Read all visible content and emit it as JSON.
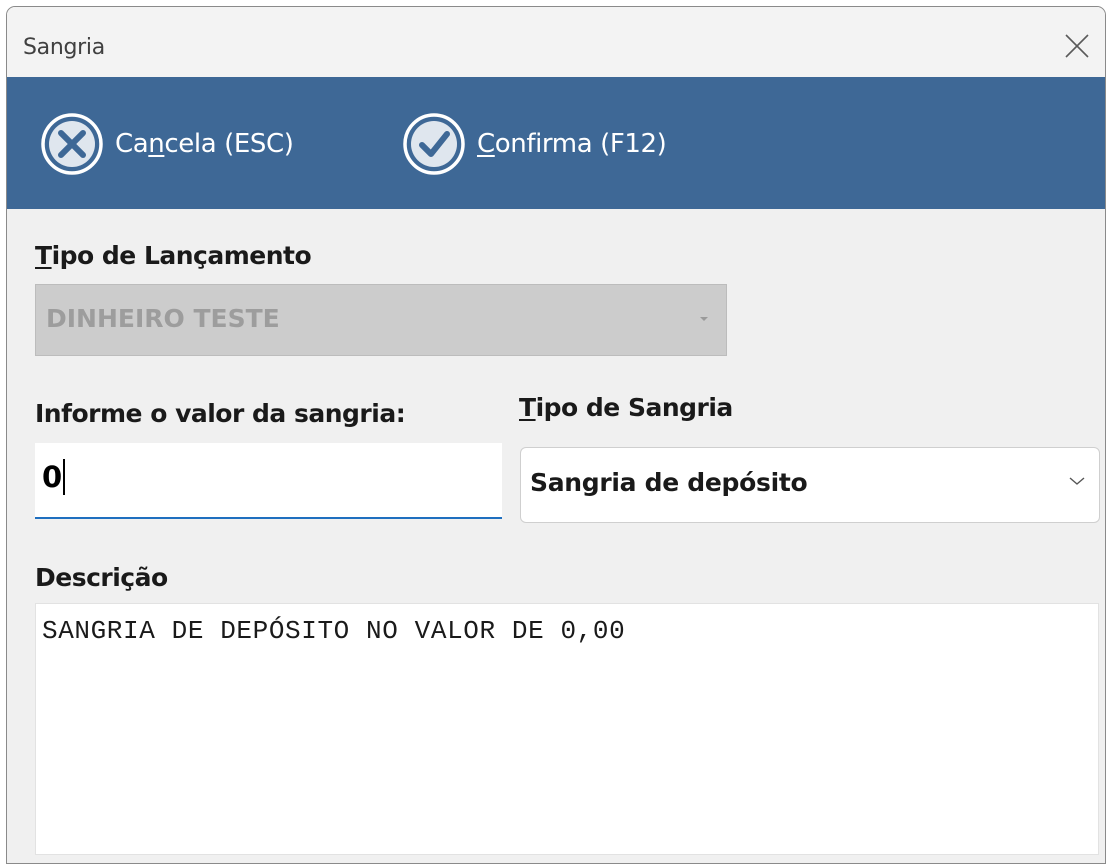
{
  "window": {
    "title": "Sangria"
  },
  "toolbar": {
    "cancel": {
      "prefix": "Ca",
      "mnemonic": "n",
      "suffix": "cela (ESC)",
      "icon": "cancel-circle-x-icon"
    },
    "confirm": {
      "prefix": "",
      "mnemonic": "C",
      "suffix": "onfirma (F12)",
      "icon": "confirm-circle-check-icon"
    }
  },
  "form": {
    "tipo_lancamento": {
      "label_mnemonic": "T",
      "label_rest": "ipo de Lançamento",
      "value": "DINHEIRO TESTE",
      "disabled": true
    },
    "valor": {
      "label": "Informe o valor da sangria:",
      "value": "0"
    },
    "tipo_sangria": {
      "label_mnemonic": "T",
      "label_rest": "ipo de Sangria",
      "value": "Sangria de depósito"
    },
    "descricao": {
      "label": "Descrição",
      "value": "SANGRIA DE DEPÓSITO NO VALOR DE 0,00"
    }
  },
  "colors": {
    "toolbar_bg": "#3e6896",
    "focus_underline": "#1f6fbf",
    "window_bg": "#f0f0f0"
  }
}
